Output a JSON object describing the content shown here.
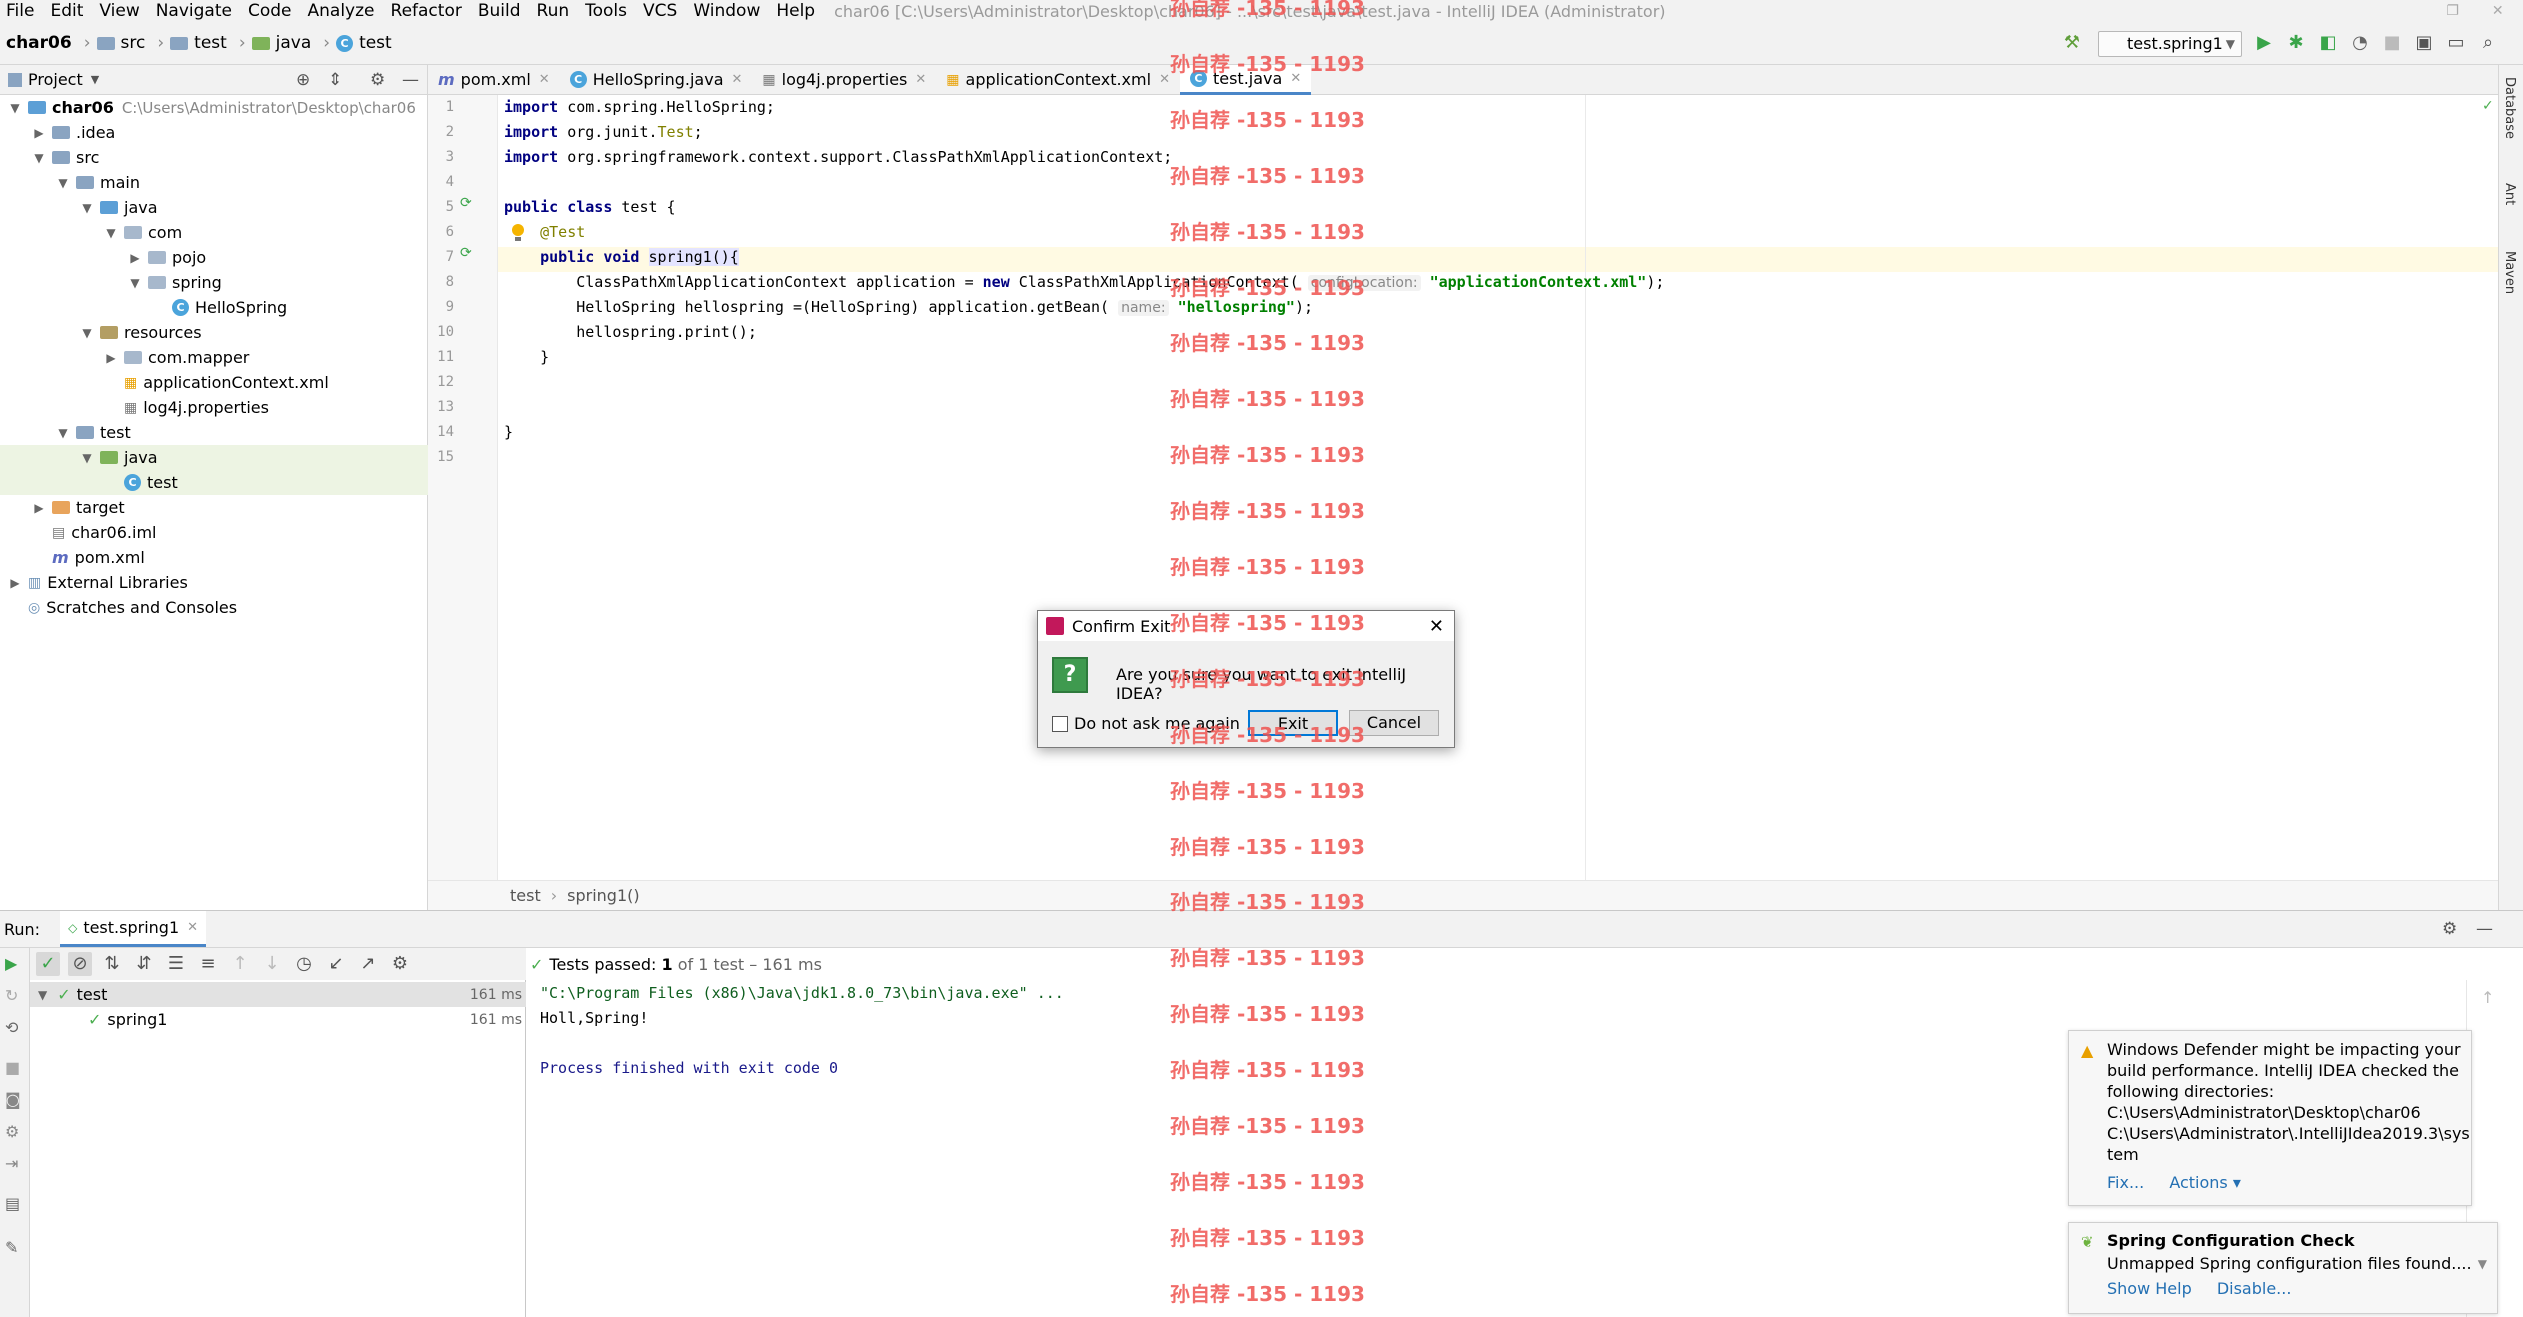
{
  "menu": [
    "File",
    "Edit",
    "View",
    "Navigate",
    "Code",
    "Analyze",
    "Refactor",
    "Build",
    "Run",
    "Tools",
    "VCS",
    "Window",
    "Help"
  ],
  "window_title": "char06 [C:\\Users\\Administrator\\Desktop\\char06] - ...\\src\\test\\java\\test.java - IntelliJ IDEA (Administrator)",
  "breadcrumb": [
    "char06",
    "src",
    "test",
    "java",
    "test"
  ],
  "run_config": "test.spring1",
  "project": {
    "header": "Project",
    "tree": [
      {
        "label": "char06",
        "path": "C:\\Users\\Administrator\\Desktop\\char06",
        "depth": 0,
        "open": true,
        "icon": "module-folder"
      },
      {
        "label": ".idea",
        "depth": 1,
        "open": false,
        "icon": "folder"
      },
      {
        "label": "src",
        "depth": 1,
        "open": true,
        "icon": "folder"
      },
      {
        "label": "main",
        "depth": 2,
        "open": true,
        "icon": "folder"
      },
      {
        "label": "java",
        "depth": 3,
        "open": true,
        "icon": "source-folder"
      },
      {
        "label": "com",
        "depth": 4,
        "open": true,
        "icon": "package"
      },
      {
        "label": "pojo",
        "depth": 5,
        "open": false,
        "icon": "package"
      },
      {
        "label": "spring",
        "depth": 5,
        "open": true,
        "icon": "package"
      },
      {
        "label": "HelloSpring",
        "depth": 6,
        "icon": "class"
      },
      {
        "label": "resources",
        "depth": 3,
        "open": true,
        "icon": "resources-folder"
      },
      {
        "label": "com.mapper",
        "depth": 4,
        "open": false,
        "icon": "package"
      },
      {
        "label": "applicationContext.xml",
        "depth": 4,
        "icon": "xml"
      },
      {
        "label": "log4j.properties",
        "depth": 4,
        "icon": "properties"
      },
      {
        "label": "test",
        "depth": 2,
        "open": true,
        "icon": "folder"
      },
      {
        "label": "java",
        "depth": 3,
        "open": true,
        "icon": "test-folder"
      },
      {
        "label": "test",
        "depth": 4,
        "icon": "class"
      },
      {
        "label": "target",
        "depth": 1,
        "open": false,
        "icon": "excluded-folder"
      },
      {
        "label": "char06.iml",
        "depth": 1,
        "icon": "iml"
      },
      {
        "label": "pom.xml",
        "depth": 1,
        "icon": "maven"
      },
      {
        "label": "External Libraries",
        "depth": 0,
        "open": false,
        "icon": "libraries"
      },
      {
        "label": "Scratches and Consoles",
        "depth": 0,
        "icon": "scratches"
      }
    ]
  },
  "tabs": [
    {
      "label": "pom.xml",
      "icon": "maven"
    },
    {
      "label": "HelloSpring.java",
      "icon": "class"
    },
    {
      "label": "log4j.properties",
      "icon": "properties"
    },
    {
      "label": "applicationContext.xml",
      "icon": "xml"
    },
    {
      "label": "test.java",
      "icon": "class",
      "active": true
    }
  ],
  "code_lines": [
    "1",
    "2",
    "3",
    "4",
    "5",
    "6",
    "7",
    "8",
    "9",
    "10",
    "11",
    "12",
    "13",
    "14",
    "15"
  ],
  "code": {
    "l1": "com.spring.HelloSpring;",
    "l2a": "org.junit.",
    "l2b": "Test",
    "l3": "org.springframework.context.support.ClassPathXmlApplicationContext;",
    "kw_import": "import",
    "kw_public": "public",
    "kw_class": "class",
    "kw_void": "void",
    "kw_new": "new",
    "class_name": "test {",
    "annotation": "@Test",
    "method": "spring1(){",
    "l8a": "ClassPathXmlApplicationContext application = ",
    "l8b": "ClassPathXmlApplicationContext(",
    "l8hint": "configLocation:",
    "l8str": "\"applicationContext.xml\"",
    "l8end": ");",
    "l9a": "HelloSpring hellospring =(HelloSpring) application.getBean(",
    "l9hint": "name:",
    "l9str": "\"hellospring\"",
    "l9end": ");",
    "l10": "hellospring.print();",
    "close1": "}",
    "close2": "}"
  },
  "editor_breadcrumb": [
    "test",
    "spring1()"
  ],
  "right_tools": [
    "Database",
    "Ant",
    "Maven"
  ],
  "run": {
    "label": "Run:",
    "tab": "test.spring1",
    "status_prefix": "Tests passed:",
    "status_count": "1",
    "status_suffix": "of 1 test – 161 ms",
    "tree": [
      {
        "label": "test",
        "time": "161 ms"
      },
      {
        "label": "spring1",
        "time": "161 ms"
      }
    ],
    "console": [
      "\"C:\\Program Files (x86)\\Java\\jdk1.8.0_73\\bin\\java.exe\" ...",
      "Holl,Spring!",
      "",
      "Process finished with exit code 0"
    ]
  },
  "notifications": {
    "defender": {
      "text": [
        "Windows Defender might be impacting your",
        "build performance. IntelliJ IDEA checked the",
        "following directories:",
        "C:\\Users\\Administrator\\Desktop\\char06",
        "C:\\Users\\Administrator\\.IntelliJIdea2019.3\\sys",
        "tem"
      ],
      "fix": "Fix...",
      "actions": "Actions ▾"
    },
    "spring": {
      "title": "Spring Configuration Check",
      "text": "Unmapped Spring configuration files found....",
      "show_help": "Show Help",
      "disable": "Disable..."
    }
  },
  "dialog": {
    "title": "Confirm Exit",
    "message": "Are you sure you want to exit IntelliJ IDEA?",
    "checkbox": "Do not ask me again",
    "exit": "Exit",
    "cancel": "Cancel"
  },
  "watermark": "孙自荐 -135 - 1193",
  "colors": {
    "accent": "#4a86c8",
    "pass": "#4caf50",
    "watermark": "#ef5350"
  }
}
